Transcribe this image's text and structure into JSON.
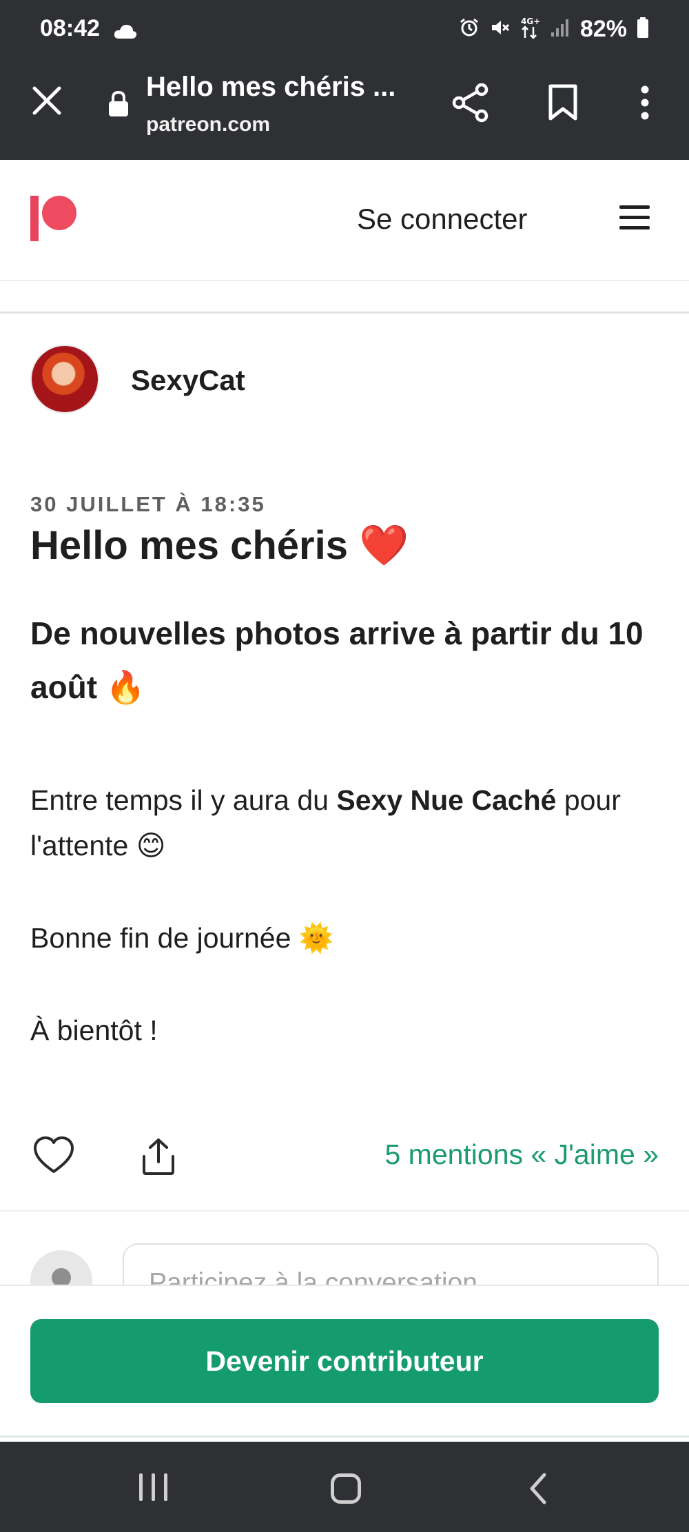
{
  "status_bar": {
    "time": "08:42",
    "battery": "82%",
    "icons": [
      "cloud-icon",
      "alarm-icon",
      "mute-icon",
      "data-4g-icon",
      "signal-icon",
      "battery-icon"
    ]
  },
  "browser": {
    "title": "Hello mes chéris ...",
    "domain": "patreon.com",
    "icons": [
      "close-icon",
      "lock-icon",
      "share-icon",
      "bookmark-icon",
      "more-vert-icon"
    ]
  },
  "site_header": {
    "login_label": "Se connecter",
    "brand_color": "#ee4b60",
    "icons": [
      "patreon-logo",
      "hamburger-menu-icon"
    ]
  },
  "post": {
    "author": "SexyCat",
    "date": "30 JUILLET À 18:35",
    "title": "Hello mes chéris ❤️",
    "subtitle": "De nouvelles photos arrive à partir du 10 août 🔥",
    "para1_before": "Entre temps il y aura du ",
    "para1_bold": "Sexy Nue Caché",
    "para1_after": " pour l'attente 😊",
    "para2": "Bonne fin de journée 🌞",
    "para3": "À bientôt !"
  },
  "actions": {
    "likes_text": "5 mentions « J'aime »",
    "accent_color": "#1a9b70",
    "icons": [
      "heart-icon",
      "upload-share-icon"
    ]
  },
  "comment": {
    "placeholder": "Participez à la conversation"
  },
  "cta": {
    "label": "Devenir contributeur",
    "color": "#149b6e"
  },
  "nav_bar": {
    "icons": [
      "recents-icon",
      "home-icon",
      "back-icon"
    ]
  }
}
